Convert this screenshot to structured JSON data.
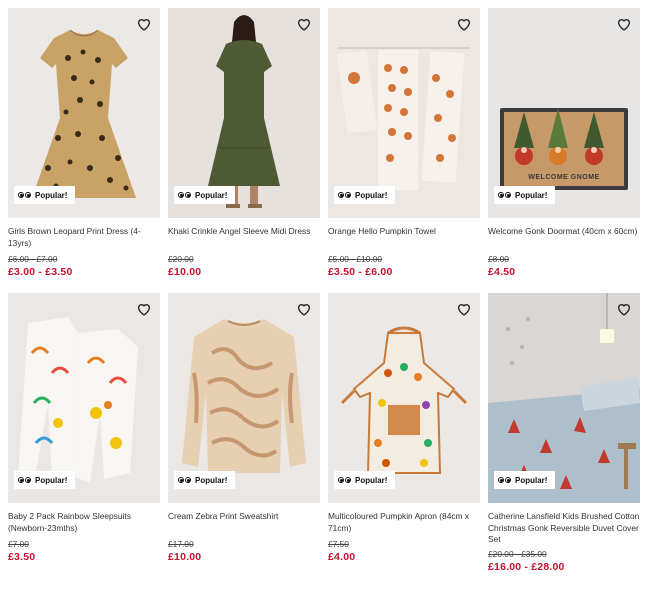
{
  "products": [
    {
      "title": "Girls Brown Leopard Print Dress (4-13yrs)",
      "was": "£6.00 - £7.00",
      "now": "£3.00 - £3.50",
      "badge": "Popular!"
    },
    {
      "title": "Khaki Crinkle Angel Sleeve Midi Dress",
      "was": "£20.00",
      "now": "£10.00",
      "badge": "Popular!"
    },
    {
      "title": "Orange Hello Pumpkin Towel",
      "was": "£5.00 - £10.00",
      "now": "£3.50 - £6.00",
      "badge": "Popular!"
    },
    {
      "title": "Welcome Gonk Doormat (40cm x 60cm)",
      "was": "£8.00",
      "now": "£4.50",
      "badge": "Popular!",
      "art_text": "WELCOME GNOME"
    },
    {
      "title": "Baby 2 Pack Rainbow Sleepsuits (Newborn-23mths)",
      "was": "£7.00",
      "now": "£3.50",
      "badge": "Popular!"
    },
    {
      "title": "Cream Zebra Print Sweatshirt",
      "was": "£17.00",
      "now": "£10.00",
      "badge": "Popular!"
    },
    {
      "title": "Multicoloured Pumpkin Apron (84cm x 71cm)",
      "was": "£7.50",
      "now": "£4.00",
      "badge": "Popular!"
    },
    {
      "title": "Catherine Lansfield Kids Brushed Cotton Christmas Gonk Reversible Duvet Cover Set",
      "was": "£20.00 - £35.00",
      "now": "£16.00 - £28.00",
      "badge": "Popular!"
    }
  ],
  "icons": {
    "wishlist": "heart-outline-icon",
    "popular": "eyes-icon"
  },
  "colors": {
    "sale_price": "#c8102e",
    "image_bg": "#e9e4e0"
  }
}
